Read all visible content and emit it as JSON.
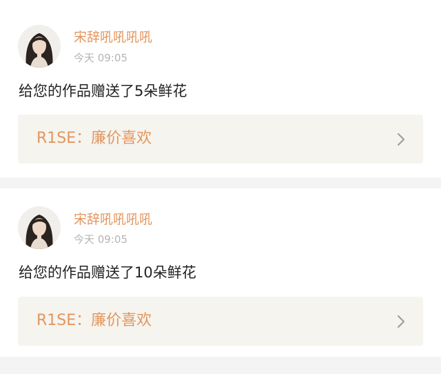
{
  "colors": {
    "accent": "#e3965f",
    "timestamp": "#b4b4b4",
    "text": "#222222",
    "link_bg": "#f5f4ee",
    "page_bg": "#f4f4f4",
    "card_bg": "#ffffff"
  },
  "notifications": [
    {
      "avatar_icon": "user-avatar",
      "username": "宋辞吼吼吼吼",
      "time": "今天 09:05",
      "message": "给您的作品赠送了5朵鲜花",
      "work_title": "R1SE：廉价喜欢",
      "chevron_icon": "chevron-right-icon"
    },
    {
      "avatar_icon": "user-avatar",
      "username": "宋辞吼吼吼吼",
      "time": "今天 09:05",
      "message": "给您的作品赠送了10朵鲜花",
      "work_title": "R1SE：廉价喜欢",
      "chevron_icon": "chevron-right-icon"
    }
  ]
}
